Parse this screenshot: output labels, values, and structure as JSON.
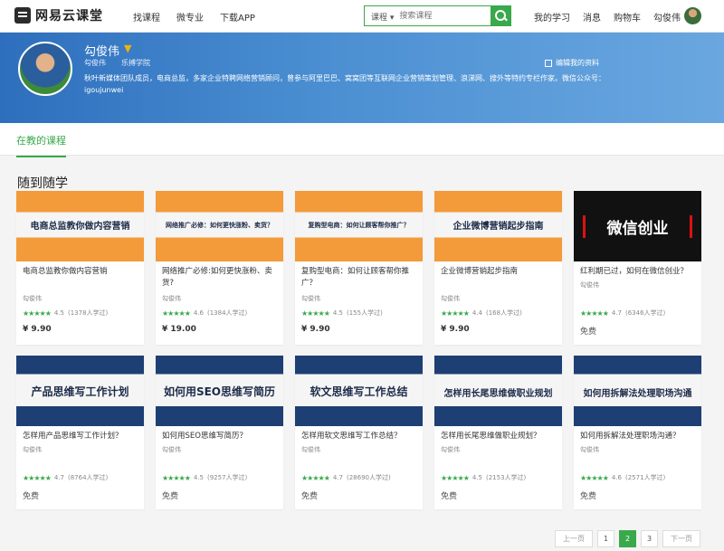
{
  "app": {
    "logo_text": "网易云课堂",
    "nav": [
      "找课程",
      "微专业",
      "下载APP"
    ],
    "search": {
      "category": "课程 ▾",
      "placeholder": "搜索课程"
    },
    "user_links": [
      "我的学习",
      "消息",
      "购物车",
      "勾俊伟"
    ],
    "accent_color": "#39a94b"
  },
  "profile": {
    "name": "勾俊伟",
    "tag": "▼",
    "sub_name": "勾俊伟",
    "school": "乐搏学院",
    "edit_label": "编辑我的资料",
    "bio": "秋叶新媒体团队成员，电商总监，多家企业特聘网络营销顾问，曾参与阿里巴巴、窝窝团等互联网企业营销策划管理、浪涕网、搜外等特约专栏作家。微信公众号：igoujunwei"
  },
  "tabs": {
    "active": "在教的课程"
  },
  "section_title": "随到随学",
  "courses": [
    {
      "thumb": "电商总监教你做内容营销",
      "title": "电商总监教你做内容营销",
      "author": "勾俊伟",
      "rating": "4.5",
      "learners": "(1378人学过)",
      "price": "¥ 9.90"
    },
    {
      "thumb": "网络推广必修：如何更快涨粉、卖货？",
      "title": "网络推广必修:如何更快涨粉、卖货?",
      "author": "勾俊伟",
      "rating": "4.6",
      "learners": "(1384人学过)",
      "price": "¥ 19.00"
    },
    {
      "thumb": "复购型电商：如何让顾客帮你推广？",
      "title": "复购型电商：如何让顾客帮你推广？",
      "author": "勾俊伟",
      "rating": "4.5",
      "learners": "(155人学过)",
      "price": "¥ 9.90"
    },
    {
      "thumb": "企业微博营销起步指南",
      "title": "企业微博营销起步指南",
      "author": "勾俊伟",
      "rating": "4.4",
      "learners": "(168人学过)",
      "price": "¥ 9.90"
    },
    {
      "thumb": "微信创业",
      "title": "红利期已过，如何在微信创业？",
      "author": "勾俊伟",
      "rating": "4.7",
      "learners": "(6346人学过)",
      "price": "免费"
    },
    {
      "thumb": "产品思维写工作计划",
      "title": "怎样用产品思维写工作计划？",
      "author": "勾俊伟",
      "rating": "4.7",
      "learners": "(8764人学过)",
      "price": "免费"
    },
    {
      "thumb": "如何用SEO思维写简历",
      "title": "如何用SEO思维写简历？",
      "author": "勾俊伟",
      "rating": "4.5",
      "learners": "(9257人学过)",
      "price": "免费"
    },
    {
      "thumb": "软文思维写工作总结",
      "title": "怎样用软文思维写工作总结？",
      "author": "勾俊伟",
      "rating": "4.7",
      "learners": "(28690人学过)",
      "price": "免费"
    },
    {
      "thumb": "怎样用长尾思维做职业规划",
      "title": "怎样用长尾思维做职业规划？",
      "author": "勾俊伟",
      "rating": "4.5",
      "learners": "(2153人学过)",
      "price": "免费"
    },
    {
      "thumb": "如何用拆解法处理职场沟通",
      "title": "如何用拆解法处理职场沟通？",
      "author": "勾俊伟",
      "rating": "4.6",
      "learners": "(2571人学过)",
      "price": "免费"
    }
  ],
  "stars": "★★★★★",
  "pagination": {
    "prev": "上一页",
    "pages": [
      "1",
      "2",
      "3"
    ],
    "current": "2",
    "next": "下一页"
  }
}
